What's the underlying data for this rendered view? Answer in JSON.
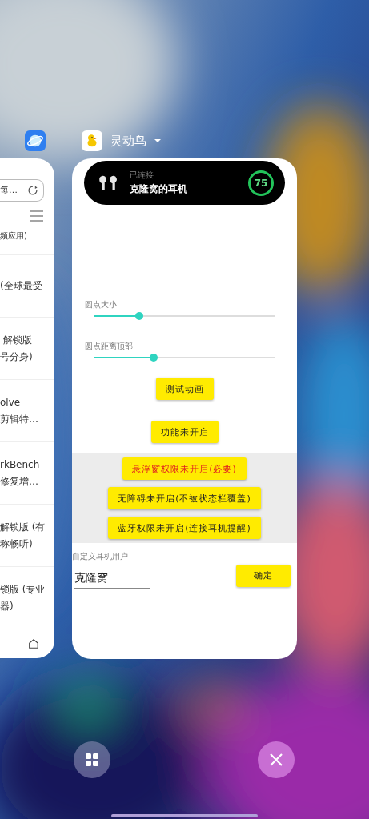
{
  "left_card": {
    "search_text": "每…",
    "items": [
      {
        "lines": [
          "频应用)"
        ]
      },
      {
        "lines": [
          "(全球最受"
        ]
      },
      {
        "lines": [
          " 解锁版",
          "号分身)"
        ]
      },
      {
        "lines": [
          "olve",
          "剪辑特…"
        ]
      },
      {
        "lines": [
          "rkBench",
          "修复增…"
        ]
      },
      {
        "lines": [
          "解锁版 (有",
          "称畅听)"
        ]
      },
      {
        "lines": [
          "锁版 (专业",
          "器)"
        ]
      }
    ]
  },
  "main_card": {
    "app_name": "灵动鸟",
    "island": {
      "status": "已连接",
      "device": "克隆窝的耳机",
      "battery": "75"
    },
    "sliders": [
      {
        "label": "圆点大小",
        "level": 0.25
      },
      {
        "label": "圆点距离顶部",
        "level": 0.33
      }
    ],
    "test_button": "测试动画",
    "feature_button": "功能未开启",
    "permission_buttons": [
      {
        "label": "悬浮窗权限未开启(必要)",
        "kind": "alert"
      },
      {
        "label": "无障碍未开启(不被状态栏覆盖)",
        "kind": "normal"
      },
      {
        "label": "蓝牙权限未开启(连接耳机提醒)",
        "kind": "normal"
      }
    ],
    "custom_user": {
      "label": "自定义耳机用户",
      "value": "克隆窝",
      "button": "确定"
    }
  }
}
